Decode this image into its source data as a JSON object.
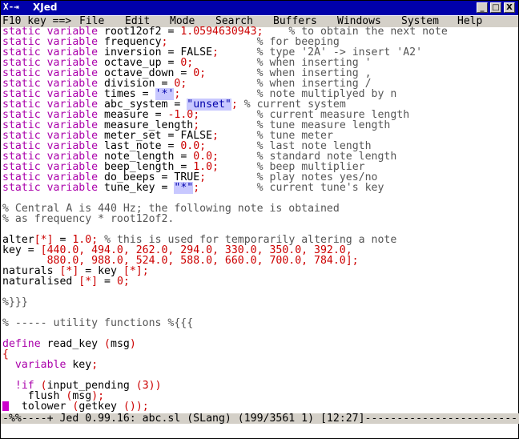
{
  "window": {
    "title": "XJed",
    "icon": "x-window-icon",
    "buttons": [
      "_",
      "□",
      "X"
    ]
  },
  "menubar": {
    "items": [
      "F10 key ==>",
      "File",
      "Edit",
      "Mode",
      "Search",
      "Buffers",
      "Windows",
      "System",
      "Help"
    ]
  },
  "editor": {
    "lines": [
      [
        {
          "t": "static variable ",
          "c": "kw"
        },
        {
          "t": "root12of2 ",
          "c": ""
        },
        {
          "t": "= ",
          "c": ""
        },
        {
          "t": "1.0594630943",
          "c": "num"
        },
        {
          "t": ";",
          "c": "op"
        },
        {
          "t": "    % to obtain the next note",
          "c": "cmt"
        }
      ],
      [
        {
          "t": "static variable ",
          "c": "kw"
        },
        {
          "t": "frequency",
          "c": ""
        },
        {
          "t": ";",
          "c": "op"
        },
        {
          "t": "              % for beeping",
          "c": "cmt"
        }
      ],
      [
        {
          "t": "static variable ",
          "c": "kw"
        },
        {
          "t": "inversion = FALSE",
          "c": ""
        },
        {
          "t": ";",
          "c": "op"
        },
        {
          "t": "      % type '2A' -> insert 'A2'",
          "c": "cmt"
        }
      ],
      [
        {
          "t": "static variable ",
          "c": "kw"
        },
        {
          "t": "octave_up = ",
          "c": ""
        },
        {
          "t": "0",
          "c": "num"
        },
        {
          "t": ";",
          "c": "op"
        },
        {
          "t": "          % when inserting '",
          "c": "cmt"
        }
      ],
      [
        {
          "t": "static variable ",
          "c": "kw"
        },
        {
          "t": "octave_down = ",
          "c": ""
        },
        {
          "t": "0",
          "c": "num"
        },
        {
          "t": ";",
          "c": "op"
        },
        {
          "t": "        % when inserting ,",
          "c": "cmt"
        }
      ],
      [
        {
          "t": "static variable ",
          "c": "kw"
        },
        {
          "t": "division = ",
          "c": ""
        },
        {
          "t": "0",
          "c": "num"
        },
        {
          "t": ";",
          "c": "op"
        },
        {
          "t": "           % when inserting /",
          "c": "cmt"
        }
      ],
      [
        {
          "t": "static variable ",
          "c": "kw"
        },
        {
          "t": "times = ",
          "c": ""
        },
        {
          "t": "'*'",
          "c": "str sel"
        },
        {
          "t": ";",
          "c": "op"
        },
        {
          "t": "            % note multiplyed by n",
          "c": "cmt"
        }
      ],
      [
        {
          "t": "static variable ",
          "c": "kw"
        },
        {
          "t": "abc_system = ",
          "c": ""
        },
        {
          "t": "\"unset\"",
          "c": "str sel"
        },
        {
          "t": ";",
          "c": "op"
        },
        {
          "t": " % current system",
          "c": "cmt"
        }
      ],
      [
        {
          "t": "static variable ",
          "c": "kw"
        },
        {
          "t": "measure = ",
          "c": ""
        },
        {
          "t": "-1.0",
          "c": "num"
        },
        {
          "t": ";",
          "c": "op"
        },
        {
          "t": "         % current measure length",
          "c": "cmt"
        }
      ],
      [
        {
          "t": "static variable ",
          "c": "kw"
        },
        {
          "t": "measure_length",
          "c": ""
        },
        {
          "t": ";",
          "c": "op"
        },
        {
          "t": "         % tune measure length",
          "c": "cmt"
        }
      ],
      [
        {
          "t": "static variable ",
          "c": "kw"
        },
        {
          "t": "meter_set = FALSE",
          "c": ""
        },
        {
          "t": ";",
          "c": "op"
        },
        {
          "t": "      % tune meter",
          "c": "cmt"
        }
      ],
      [
        {
          "t": "static variable ",
          "c": "kw"
        },
        {
          "t": "last_note = ",
          "c": ""
        },
        {
          "t": "0.0",
          "c": "num"
        },
        {
          "t": ";",
          "c": "op"
        },
        {
          "t": "        % last note length",
          "c": "cmt"
        }
      ],
      [
        {
          "t": "static variable ",
          "c": "kw"
        },
        {
          "t": "note_length = ",
          "c": ""
        },
        {
          "t": "0.0",
          "c": "num"
        },
        {
          "t": ";",
          "c": "op"
        },
        {
          "t": "      % standard note length",
          "c": "cmt"
        }
      ],
      [
        {
          "t": "static variable ",
          "c": "kw"
        },
        {
          "t": "beep_length = ",
          "c": ""
        },
        {
          "t": "1.0",
          "c": "num"
        },
        {
          "t": ";",
          "c": "op"
        },
        {
          "t": "      % beep multiplier",
          "c": "cmt"
        }
      ],
      [
        {
          "t": "static variable ",
          "c": "kw"
        },
        {
          "t": "do_beeps = TRUE",
          "c": ""
        },
        {
          "t": ";",
          "c": "op"
        },
        {
          "t": "        % play notes yes/no",
          "c": "cmt"
        }
      ],
      [
        {
          "t": "static variable ",
          "c": "kw"
        },
        {
          "t": "tune_key = ",
          "c": ""
        },
        {
          "t": "\"*\"",
          "c": "str sel"
        },
        {
          "t": ";",
          "c": "op"
        },
        {
          "t": "         % current tune's key",
          "c": "cmt"
        }
      ],
      [
        {
          "t": "",
          "c": ""
        }
      ],
      [
        {
          "t": "% Central A is 440 Hz; the following note is obtained",
          "c": "cmt"
        }
      ],
      [
        {
          "t": "% as frequency * root12of2.",
          "c": "cmt"
        }
      ],
      [
        {
          "t": "",
          "c": ""
        }
      ],
      [
        {
          "t": "alter",
          "c": ""
        },
        {
          "t": "[*]",
          "c": "op"
        },
        {
          "t": " = ",
          "c": ""
        },
        {
          "t": "1.0",
          "c": "num"
        },
        {
          "t": ";",
          "c": "op"
        },
        {
          "t": " % this is used for temporarily altering a note",
          "c": "cmt"
        }
      ],
      [
        {
          "t": "key = ",
          "c": ""
        },
        {
          "t": "[440.0, 494.0, 262.0, 294.0, 330.0, 350.0, 392.0,",
          "c": "num"
        }
      ],
      [
        {
          "t": "       ",
          "c": ""
        },
        {
          "t": "880.0, 988.0, 524.0, 588.0, 660.0, 700.0, 784.0];",
          "c": "num"
        }
      ],
      [
        {
          "t": "naturals ",
          "c": ""
        },
        {
          "t": "[*]",
          "c": "op"
        },
        {
          "t": " = key ",
          "c": ""
        },
        {
          "t": "[*]",
          "c": "op"
        },
        {
          "t": ";",
          "c": "op"
        }
      ],
      [
        {
          "t": "naturalised ",
          "c": ""
        },
        {
          "t": "[*]",
          "c": "op"
        },
        {
          "t": " = ",
          "c": ""
        },
        {
          "t": "0",
          "c": "num"
        },
        {
          "t": ";",
          "c": "op"
        }
      ],
      [
        {
          "t": "",
          "c": ""
        }
      ],
      [
        {
          "t": "%}}}",
          "c": "cmt"
        }
      ],
      [
        {
          "t": "",
          "c": ""
        }
      ],
      [
        {
          "t": "% ----- utility functions %{{{",
          "c": "cmt"
        }
      ],
      [
        {
          "t": "",
          "c": ""
        }
      ],
      [
        {
          "t": "define ",
          "c": "kw"
        },
        {
          "t": "read_key ",
          "c": ""
        },
        {
          "t": "(",
          "c": "op"
        },
        {
          "t": "msg",
          "c": ""
        },
        {
          "t": ")",
          "c": "op"
        }
      ],
      [
        {
          "t": "{",
          "c": "op"
        }
      ],
      [
        {
          "t": "  ",
          "c": ""
        },
        {
          "t": "variable ",
          "c": "kw"
        },
        {
          "t": "key",
          "c": ""
        },
        {
          "t": ";",
          "c": "op"
        }
      ],
      [
        {
          "t": "",
          "c": ""
        }
      ],
      [
        {
          "t": "  ",
          "c": ""
        },
        {
          "t": "!if ",
          "c": "kw"
        },
        {
          "t": "(",
          "c": "op"
        },
        {
          "t": "input_pending ",
          "c": ""
        },
        {
          "t": "(3))",
          "c": "op"
        }
      ],
      [
        {
          "t": "    flush ",
          "c": ""
        },
        {
          "t": "(",
          "c": "op"
        },
        {
          "t": "msg",
          "c": ""
        },
        {
          "t": ");",
          "c": "op"
        }
      ],
      [
        {
          "t": "  tolower ",
          "c": ""
        },
        {
          "t": "(",
          "c": "op"
        },
        {
          "t": "getkey ",
          "c": ""
        },
        {
          "t": "());",
          "c": "op"
        }
      ]
    ]
  },
  "status": {
    "text": "-%%----+ Jed 0.99.16: abc.sl (SLang) (199/3561 1) [12:27]---------------------------"
  }
}
